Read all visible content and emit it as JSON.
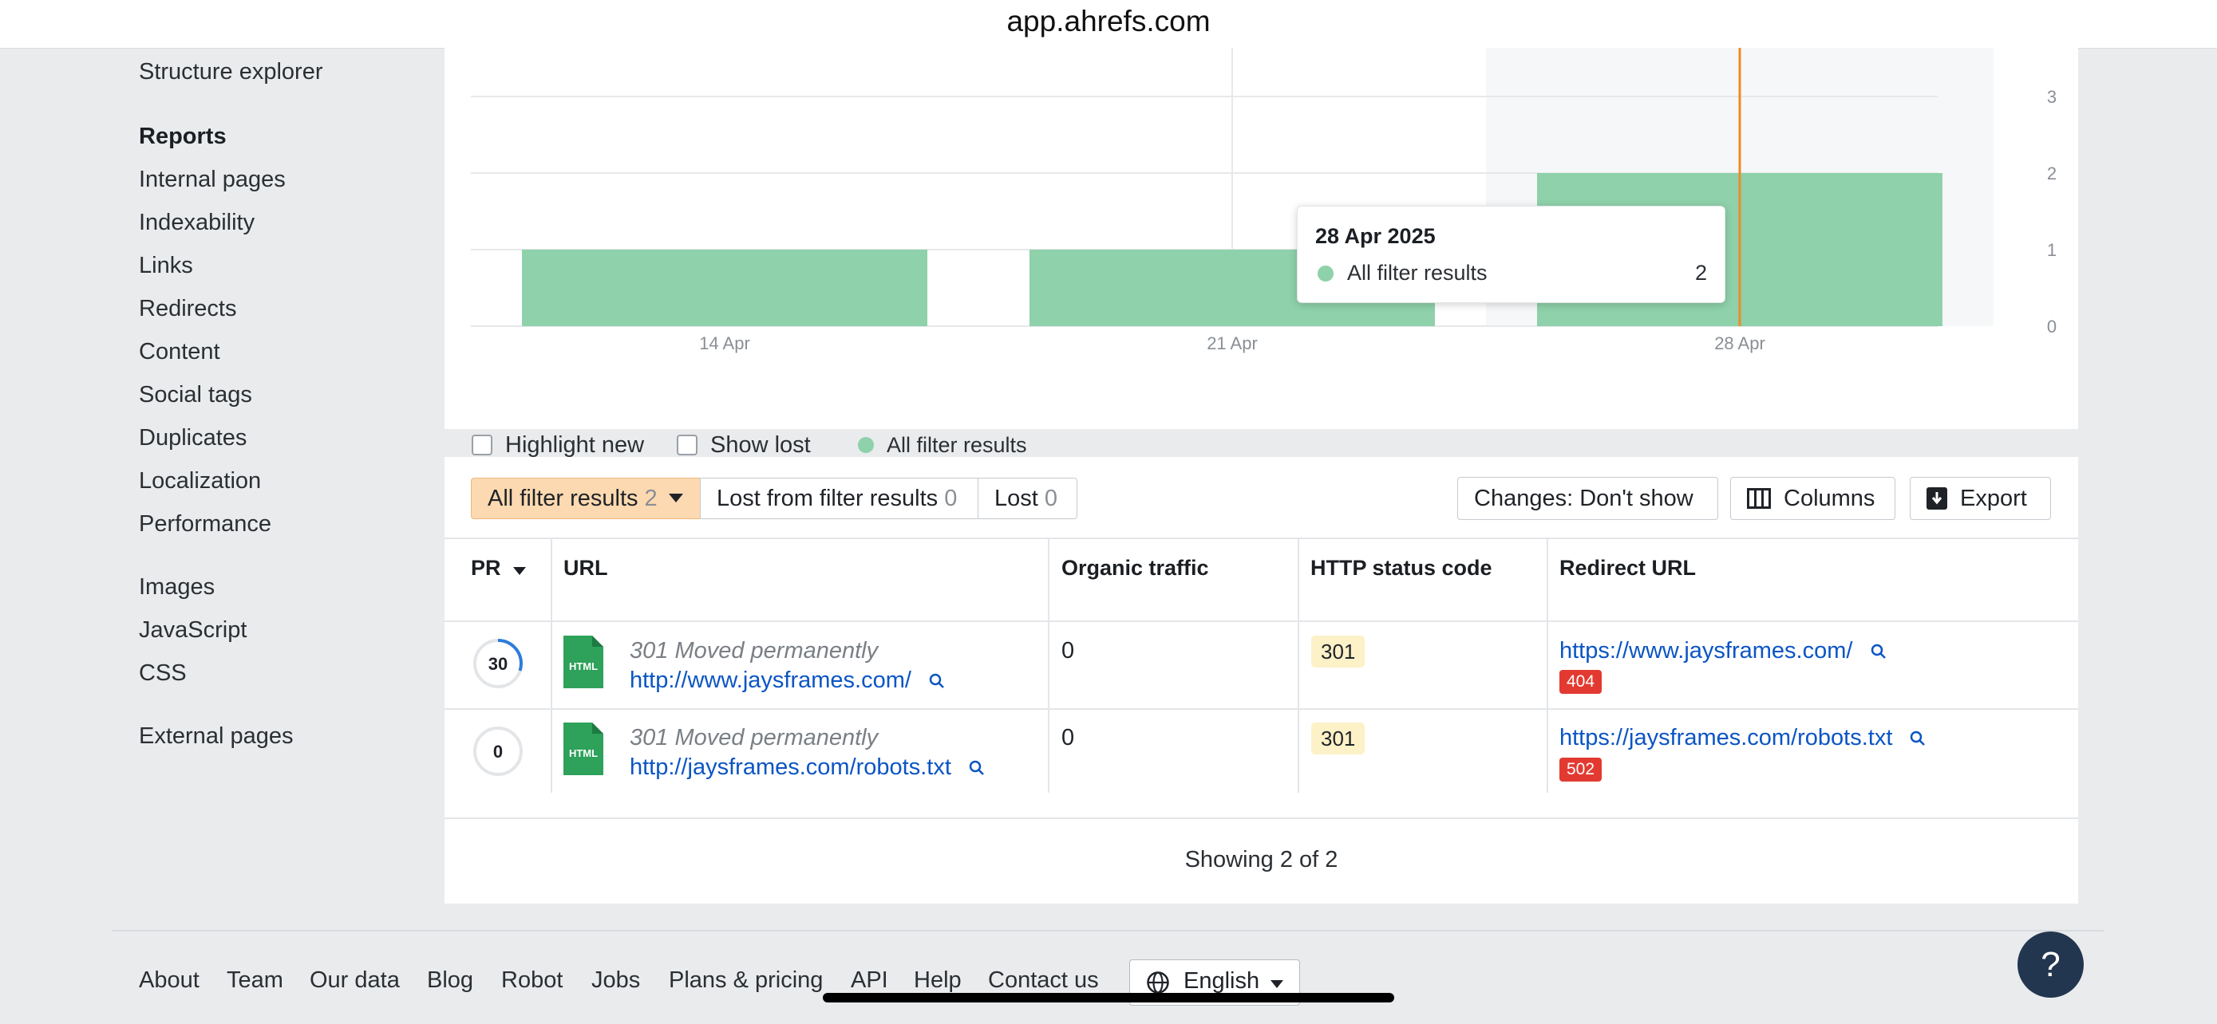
{
  "browser": {
    "url": "app.ahrefs.com"
  },
  "sidebar": {
    "top_item": "Structure explorer",
    "reports_heading": "Reports",
    "group1": [
      "Internal pages",
      "Indexability",
      "Links",
      "Redirects",
      "Content",
      "Social tags",
      "Duplicates",
      "Localization",
      "Performance"
    ],
    "group2": [
      "Images",
      "JavaScript",
      "CSS"
    ],
    "group3": [
      "External pages"
    ]
  },
  "chart_data": {
    "type": "bar",
    "categories": [
      "14 Apr",
      "21 Apr",
      "28 Apr"
    ],
    "series": [
      {
        "name": "All filter results",
        "values": [
          1,
          1,
          2
        ]
      }
    ],
    "xlabel": "",
    "ylabel": "",
    "ylim": [
      0,
      3
    ],
    "yticks": [
      "0",
      "1",
      "2",
      "3"
    ],
    "grid": true,
    "legend_position": "bottom-left",
    "highlighted_category": "28 Apr",
    "colors": {
      "bar": "#8ed1aa",
      "marker": "#f08a24"
    }
  },
  "tooltip": {
    "date": "28 Apr 2025",
    "label": "All filter results",
    "value": "2"
  },
  "legend": {
    "highlight_new": "Highlight new",
    "show_lost": "Show lost",
    "series": "All filter results"
  },
  "toolbar": {
    "tabs": [
      {
        "label": "All filter results",
        "count": "2"
      },
      {
        "label": "Lost from filter results",
        "count": "0"
      },
      {
        "label": "Lost",
        "count": "0"
      }
    ],
    "changes": "Changes: Don't show",
    "columns": "Columns",
    "export": "Export"
  },
  "table": {
    "headers": {
      "pr": "PR",
      "url": "URL",
      "traffic": "Organic traffic",
      "status": "HTTP status code",
      "redirect": "Redirect URL"
    },
    "rows": [
      {
        "pr": "30",
        "pr_fraction": 0.3,
        "file_type": "HTML",
        "status_text": "301 Moved permanently",
        "url": "http://www.jaysframes.com/",
        "traffic": "0",
        "code": "301",
        "redirect_url": "https://www.jaysframes.com/",
        "redirect_code": "404"
      },
      {
        "pr": "0",
        "pr_fraction": 0,
        "file_type": "HTML",
        "status_text": "301 Moved permanently",
        "url": "http://jaysframes.com/robots.txt",
        "traffic": "0",
        "code": "301",
        "redirect_url": "https://jaysframes.com/robots.txt",
        "redirect_code": "502"
      }
    ],
    "showing": "Showing 2 of 2"
  },
  "footer": {
    "links": [
      "About",
      "Team",
      "Our data",
      "Blog",
      "Robot",
      "Jobs",
      "Plans & pricing",
      "API",
      "Help",
      "Contact us"
    ],
    "language": "English",
    "help": "?"
  }
}
